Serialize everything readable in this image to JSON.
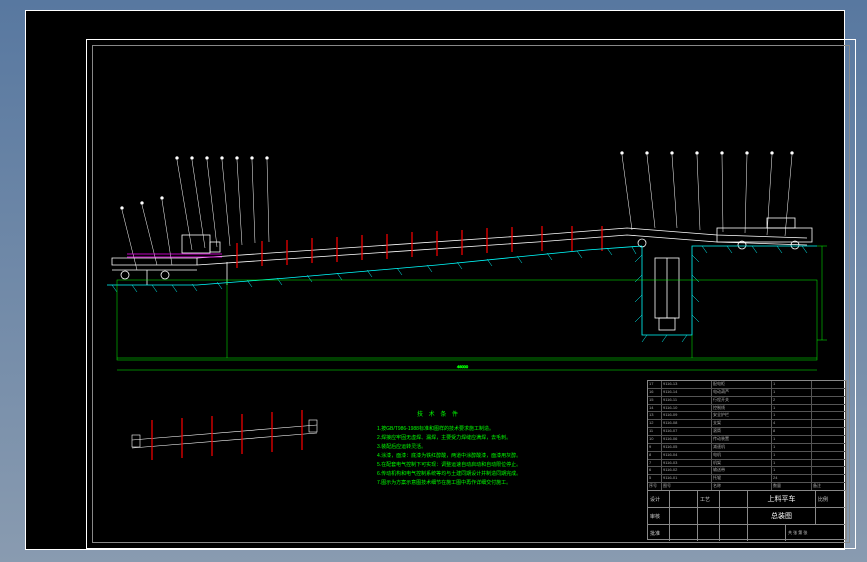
{
  "notes": {
    "title": "技 术 条 件",
    "lines": [
      "1.按GB/T986-1988标准和图样的技术要求施工制造。",
      "2.焊接应牢固无虚焊、漏焊，主要受力焊缝应满焊，去毛刺。",
      "3.装配后应运转灵活。",
      "4.涂漆，面漆：底漆为铁红醇酸，两道中涂醇酸漆，面漆用灰醇。",
      "5.在配套电气控制下可实现：调整运速自动启动和自动限位停止。",
      "6.传动机构和电气控制系统等均与土建同期设计并制造同期完成。",
      "7.图示为方案示意图技术细节在施工图中再作详细交付施工。"
    ]
  },
  "titleblock": {
    "bom": [
      {
        "n": "17",
        "a": "9116-13",
        "b": "配电柜",
        "c": "1",
        "d": ""
      },
      {
        "n": "16",
        "a": "9116-14",
        "b": "电动葫芦",
        "c": "1",
        "d": ""
      },
      {
        "n": "15",
        "a": "9116-11",
        "b": "行程开关",
        "c": "2",
        "d": ""
      },
      {
        "n": "14",
        "a": "9116-10",
        "b": "控制线",
        "c": "1",
        "d": ""
      },
      {
        "n": "13",
        "a": "9116-09",
        "b": "安全护栏",
        "c": "1",
        "d": ""
      },
      {
        "n": "12",
        "a": "9116-08",
        "b": "支架",
        "c": "4",
        "d": ""
      },
      {
        "n": "11",
        "a": "9116-07",
        "b": "滚筒",
        "c": "8",
        "d": ""
      },
      {
        "n": "10",
        "a": "9116-06",
        "b": "传动装置",
        "c": "1",
        "d": ""
      },
      {
        "n": "9",
        "a": "9116-05",
        "b": "减速机",
        "c": "1",
        "d": ""
      },
      {
        "n": "8",
        "a": "9116-04",
        "b": "电机",
        "c": "1",
        "d": ""
      },
      {
        "n": "7",
        "a": "9116-03",
        "b": "机架",
        "c": "1",
        "d": ""
      },
      {
        "n": "6",
        "a": "9116-02",
        "b": "输送带",
        "c": "1",
        "d": ""
      },
      {
        "n": "5",
        "a": "9116-01",
        "b": "托辊",
        "c": "24",
        "d": ""
      },
      {
        "n": "序号",
        "a": "图号",
        "b": "名称",
        "c": "数量",
        "d": "备注"
      }
    ],
    "r1": {
      "a": "设计",
      "b": "",
      "c": "工艺",
      "d": "",
      "e": "",
      "f": "比例"
    },
    "r2": {
      "a": "审核",
      "b": "",
      "c": "",
      "d": "",
      "e": "",
      "f": ""
    },
    "r3": {
      "a": "批准",
      "b": "",
      "c": "",
      "d": "",
      "e": "总装图",
      "f": "共 张 第 张"
    },
    "proj": "上料平车"
  },
  "dims": {
    "w": "48000",
    "h": "",
    "pit": ""
  }
}
